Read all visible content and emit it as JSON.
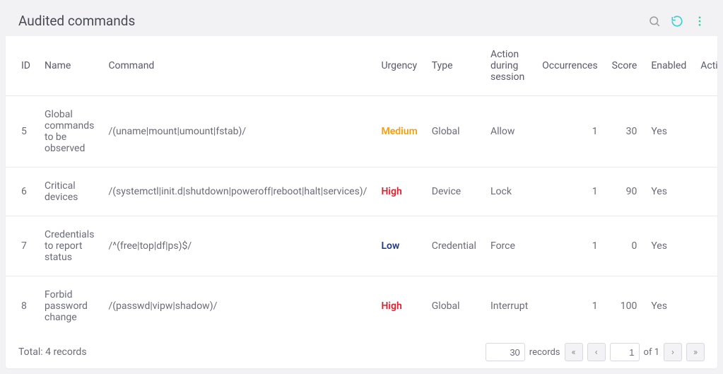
{
  "header": {
    "title": "Audited commands"
  },
  "table": {
    "columns": {
      "id": "ID",
      "name": "Name",
      "command": "Command",
      "urgency": "Urgency",
      "type": "Type",
      "action": "Action during session",
      "occurrences": "Occurrences",
      "score": "Score",
      "enabled": "Enabled",
      "actions_col": "Action"
    },
    "rows": [
      {
        "id": "5",
        "name": "Global commands to be observed",
        "command": "/(uname|mount|umount|fstab)/",
        "urgency": "Medium",
        "urgency_level": "medium",
        "type": "Global",
        "action": "Allow",
        "occurrences": "1",
        "score": "30",
        "enabled": "Yes"
      },
      {
        "id": "6",
        "name": "Critical devices",
        "command": "/(systemctl|init.d|shutdown|poweroff|reboot|halt|services)/",
        "urgency": "High",
        "urgency_level": "high",
        "type": "Device",
        "action": "Lock",
        "occurrences": "1",
        "score": "90",
        "enabled": "Yes"
      },
      {
        "id": "7",
        "name": "Credentials to report status",
        "command": "/^(free|top|df|ps)$/",
        "urgency": "Low",
        "urgency_level": "low",
        "type": "Credential",
        "action": "Force",
        "occurrences": "1",
        "score": "0",
        "enabled": "Yes"
      },
      {
        "id": "8",
        "name": "Forbid password change",
        "command": "/(passwd|vipw|shadow)/",
        "urgency": "High",
        "urgency_level": "high",
        "type": "Global",
        "action": "Interrupt",
        "occurrences": "1",
        "score": "100",
        "enabled": "Yes"
      }
    ]
  },
  "footer": {
    "total": "Total: 4 records",
    "records_label": "records",
    "page_size": "30",
    "page": "1",
    "of_label": "of 1"
  }
}
